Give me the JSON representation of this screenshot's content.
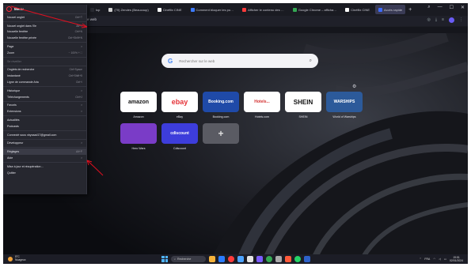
{
  "tabs": [
    {
      "label": "Icp",
      "color": "#2a2b33"
    },
    {
      "label": "(70) Zendes (Beaucoup)",
      "color": "#cfcfcf"
    },
    {
      "label": "Cinéflix CINE",
      "color": "#ffffff"
    },
    {
      "label": "Comment bloquer les pu…",
      "color": "#3d7bfd"
    },
    {
      "label": "Afficher le contenu des …",
      "color": "#ff3b3b"
    },
    {
      "label": "Google Chrome – afficha…",
      "color": "#34a853"
    },
    {
      "label": "Cinéflix CINE",
      "color": "#ffffff"
    },
    {
      "label": "Accès rapide",
      "color": "#3d6bff"
    }
  ],
  "new_tab": "+",
  "address": "Adresse web",
  "menu": {
    "title": "Menu",
    "items": [
      {
        "label": "Nouvel onglet",
        "shortcut": "Ctrl+T"
      },
      {
        "label": "Nouvel onglet dans l'île",
        "shortcut": "Alt+T"
      },
      {
        "label": "Nouvelle fenêtre",
        "shortcut": "Ctrl+N"
      },
      {
        "label": "Nouvelle fenêtre privée",
        "shortcut": "Ctrl+Shift+N"
      },
      {
        "label": "Page",
        "shortcut": ">"
      },
      {
        "label": "Zoom",
        "shortcut": "− 100% +  ⛶"
      },
      {
        "label": "Se réveiller",
        "shortcut": "",
        "dim": true
      },
      {
        "label": "Onglets de recherche",
        "shortcut": "Ctrl+Space"
      },
      {
        "label": "Instantané",
        "shortcut": "Ctrl+Shift+5"
      },
      {
        "label": "Ligne de commande Aria",
        "shortcut": "Ctrl+/"
      },
      {
        "label": "Historique",
        "shortcut": ">"
      },
      {
        "label": "Téléchargements",
        "shortcut": "Ctrl+J"
      },
      {
        "label": "Favoris",
        "shortcut": ">"
      },
      {
        "label": "Extensions",
        "shortcut": ">"
      },
      {
        "label": "Actualités",
        "shortcut": ""
      },
      {
        "label": "Podcasts",
        "shortcut": ""
      },
      {
        "label": "Connecté sous xbyxaad17@gmail.com",
        "shortcut": ""
      },
      {
        "label": "Développeur",
        "shortcut": ">"
      },
      {
        "label": "Réglages",
        "shortcut": "Alt+P",
        "highlight": true
      },
      {
        "label": "Aide",
        "shortcut": ">"
      },
      {
        "label": "Mise à jour et récupération…",
        "shortcut": ""
      },
      {
        "label": "Quitter",
        "shortcut": ""
      }
    ]
  },
  "search": {
    "placeholder": "Rechercher sur le web"
  },
  "speed_dial": [
    {
      "label": "Amazon",
      "logo": "amazon",
      "bg": "#ffffff",
      "fg": "#111111"
    },
    {
      "label": "eBay",
      "logo": "ebay",
      "bg": "#ffffff",
      "fg": "#e53238"
    },
    {
      "label": "Booking.com",
      "logo": "Booking.com",
      "bg": "#1f4aa8",
      "fg": "#ffffff"
    },
    {
      "label": "Hotels.com",
      "logo": "Hotels...",
      "bg": "#ffffff",
      "fg": "#d32f2f"
    },
    {
      "label": "SHEIN",
      "logo": "SHEIN",
      "bg": "#ffffff",
      "fg": "#111111"
    },
    {
      "label": "World of Warships",
      "logo": "WARSHIPS",
      "bg": "#2c5a9a",
      "fg": "#ffffff"
    },
    {
      "label": "Hero Wars",
      "logo": "",
      "bg": "#7a3cc7",
      "fg": "#ffffff"
    },
    {
      "label": "Cdiscount",
      "logo": "cdiscount",
      "bg": "#3d3ddb",
      "fg": "#ffffff"
    },
    {
      "label": "",
      "logo": "+",
      "bg": "#5a5b63",
      "fg": "#e0e0e0"
    }
  ],
  "taskbar": {
    "weather_temp": "5°C",
    "weather_text": "Nuageux",
    "search_label": "Recherche",
    "lang": "FRA",
    "clock_time": "19:51",
    "clock_date": "02/01/2024"
  },
  "colors": {
    "accent": "#6a5cf6",
    "opera_red": "#ff2a3a",
    "annotation": "#e01020"
  }
}
